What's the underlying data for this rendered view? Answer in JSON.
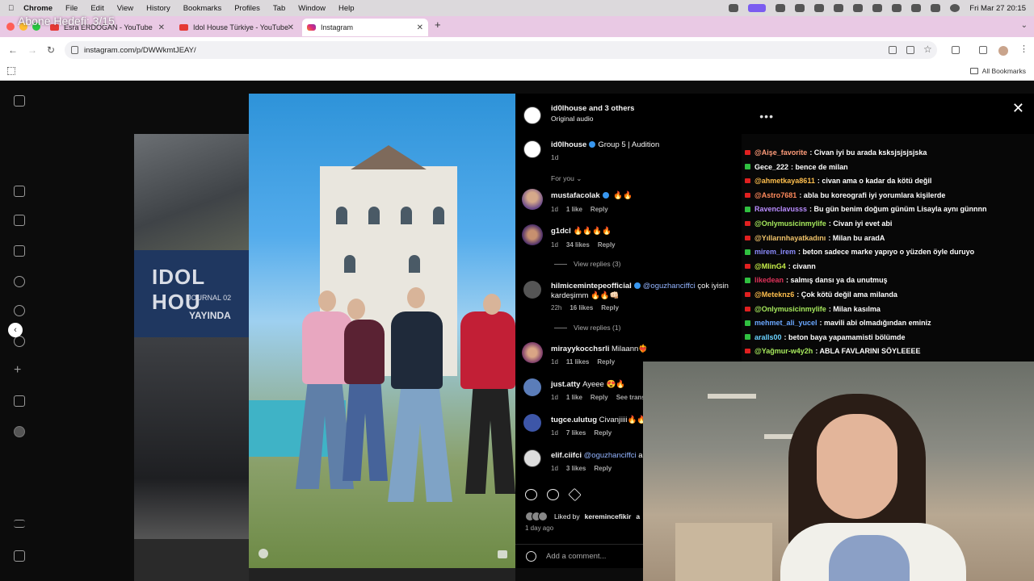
{
  "menubar": {
    "app": "Chrome",
    "items": [
      "File",
      "Edit",
      "View",
      "History",
      "Bookmarks",
      "Profiles",
      "Tab",
      "Window",
      "Help"
    ],
    "clock": "Fri Mar 27  20:15"
  },
  "watermark": "Abone Hedefi: 3/15",
  "tabs": [
    {
      "title": "Esra ERDOĞAN - YouTube"
    },
    {
      "title": "Idol House Türkiye - YouTube"
    },
    {
      "title": "Instagram"
    }
  ],
  "toolbar": {
    "url": "instagram.com/p/DWWkmtJEAY/"
  },
  "bookmarks": {
    "all_label": "All Bookmarks"
  },
  "post": {
    "author": "id0lhouse",
    "coauthors": "and 3 others",
    "audio": "Original audio",
    "caption_user": "id0lhouse",
    "caption": "Group 5 | Audition",
    "caption_time": "1d",
    "for_you": "For you",
    "idol_title": "IDOL HOU",
    "idol_journal": "JOURNAL 02",
    "idol_live": "YAYINDA"
  },
  "comments": [
    {
      "user": "mustafacolak",
      "text": "🔥🔥",
      "time": "1d",
      "likes": "1 like",
      "reply": "Reply"
    },
    {
      "user": "g1dcl",
      "text": "🔥🔥🔥🔥",
      "time": "1d",
      "likes": "34 likes",
      "reply": "Reply",
      "view_replies": "View replies (3)"
    },
    {
      "user": "hilmicemintepeofficial",
      "mention": "@oguzhanciffci",
      "text": "çok iyisin kardeşimm 🔥🔥👊🏻",
      "time": "22h",
      "likes": "16 likes",
      "reply": "Reply",
      "view_replies": "View replies (1)"
    },
    {
      "user": "mirayykocchsrli",
      "text": "Milaann❤️‍🔥",
      "time": "1d",
      "likes": "11 likes",
      "reply": "Reply"
    },
    {
      "user": "just.atty",
      "text": "Ayeee 😍🔥",
      "time": "1d",
      "likes": "1 like",
      "reply": "Reply",
      "extra": "See trans"
    },
    {
      "user": "tugce.ulutug",
      "text": "Civanjiiii🔥🔥",
      "time": "1d",
      "likes": "7 likes",
      "reply": "Reply"
    },
    {
      "user": "elif.ciifci",
      "mention": "@oguzhanciffci",
      "text": "a",
      "time": "1d",
      "likes": "3 likes",
      "reply": "Reply"
    }
  ],
  "likes": {
    "liked_by": "Liked by",
    "user": "keremincefikir",
    "rest": "a",
    "time": "1 day ago"
  },
  "add_comment": "Add a comment...",
  "chat": [
    {
      "badge": "yt",
      "name": "@Aişe_favorite",
      "color": "#ff9c7a",
      "msg": ": Civan iyi bu arada ksksjsjsjsjska"
    },
    {
      "badge": "kick",
      "name": "Gece_222",
      "color": "#ffffff",
      "msg": ": bence de milan"
    },
    {
      "badge": "yt",
      "name": "@ahmetkaya8611",
      "color": "#ffbf4d",
      "msg": ": civan ama o kadar da kötü değil"
    },
    {
      "badge": "yt",
      "name": "@Astro7681",
      "color": "#ff8a5c",
      "msg": ": abla bu koreografi iyi yorumlara kişilerde"
    },
    {
      "badge": "kick",
      "name": "Ravenclavusss",
      "color": "#b98cff",
      "msg": ": Bu gün benim doğum günüm Lisayla aynı günnnn"
    },
    {
      "badge": "yt",
      "name": "@Onlymusicinmylife",
      "color": "#a6e85c",
      "msg": ": Civan iyi evet abi"
    },
    {
      "badge": "yt",
      "name": "@Yıllarınhayatkadını",
      "color": "#f0c36a",
      "msg": ": Milan bu aradA"
    },
    {
      "badge": "kick",
      "name": "mirem_irem",
      "color": "#8c8cff",
      "msg": ": beton sadece marke yapıyo o yüzden öyle duruyo"
    },
    {
      "badge": "yt",
      "name": "@MlinG4",
      "color": "#c8f04a",
      "msg": ": civann"
    },
    {
      "badge": "kick",
      "name": "likedean",
      "color": "#e0325a",
      "msg": ": salmış dansı ya da unutmuş"
    },
    {
      "badge": "yt",
      "name": "@Meteknz6",
      "color": "#ffbf4d",
      "msg": ": Çok kötü değil ama milanda"
    },
    {
      "badge": "yt",
      "name": "@Onlymusicinmylife",
      "color": "#a6e85c",
      "msg": ": Milan kasılma"
    },
    {
      "badge": "kick",
      "name": "mehmet_ali_yucel",
      "color": "#6aa7ff",
      "msg": ": mavili abi olmadığından eminiz"
    },
    {
      "badge": "kick",
      "name": "aralls00",
      "color": "#6ad2ff",
      "msg": ": beton baya yapamamisti bölümde"
    },
    {
      "badge": "yt",
      "name": "@Yağmur-w4y2h",
      "color": "#a6e85c",
      "msg": ": ABLA FAVLARINI SÖYLEEEE"
    }
  ],
  "colors": {
    "tabstrip": "#e9c9e4",
    "accent": "#3897f0",
    "yt_red": "#e02020",
    "kick_green": "#30c040"
  }
}
